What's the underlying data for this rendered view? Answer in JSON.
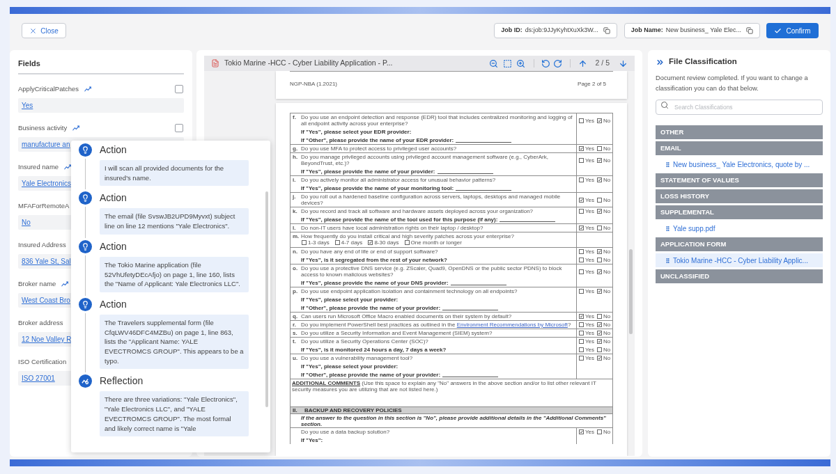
{
  "top_bar": {
    "close_button": {
      "label": "Close"
    },
    "job_id": {
      "label": "Job ID:",
      "value": "ds:job:9JJyKyhtXuXk3W..."
    },
    "job_name": {
      "label": "Job Name:",
      "value": "New business_ Yale Elec..."
    },
    "confirm_button": {
      "label": "Confirm"
    }
  },
  "fields_panel": {
    "title": "Fields",
    "fields": [
      {
        "label": "ApplyCriticalPatches",
        "extracted": true,
        "checked": false,
        "value": "Yes"
      },
      {
        "label": "Business activity",
        "extracted": true,
        "checked": false,
        "value": "manufacture an"
      },
      {
        "label": "Insured name",
        "extracted": true,
        "value": "Yale Electronics"
      },
      {
        "label": "MFAForRemoteA",
        "value": "No"
      },
      {
        "label": "Insured Address",
        "value": "836 Yale St, Sal"
      },
      {
        "label": "Broker name",
        "extracted": true,
        "value": "West Coast Bro"
      },
      {
        "label": "Broker address",
        "value": "12 Noe Valley R"
      },
      {
        "label": "ISO Certification",
        "value": "ISO 27001"
      }
    ]
  },
  "reasoning_popover": {
    "steps": [
      {
        "kind": "action",
        "title": "Action",
        "text": "I will scan all provided documents for the insured's name."
      },
      {
        "kind": "action",
        "title": "Action",
        "text": "The email (file SvswJB2UPD9Myvxt) subject line on line 12 mentions \"Yale Electronics\"."
      },
      {
        "kind": "action",
        "title": "Action",
        "text": "The Tokio Marine application (file 52VhUfetyDEcAfjo) on page 1, line 160, lists the \"Name of Applicant: Yale Electronics LLC\"."
      },
      {
        "kind": "action",
        "title": "Action",
        "text": "The Travelers supplemental form (file CfqLWV46DFC4MZBu) on page 1, line 863, lists the \"Applicant Name: YALE EVECTROMCS GROUP\". This appears to be a typo."
      },
      {
        "kind": "reflection",
        "title": "Reflection",
        "text": "There are three variations: \"Yale Electronics\", \"Yale Electronics LLC\", and \"YALE EVECTROMCS GROUP\". The most formal and likely correct name is \"Yale"
      }
    ]
  },
  "document_viewer": {
    "title": "Tokio Marine -HCC - Cyber Liability Application - P...",
    "page_indicator": "2 / 5",
    "previous_page": {
      "form_code": "NGP-NBA (1.2021)",
      "page_label": "Page 2 of 5"
    },
    "page": {
      "questions": [
        {
          "kind": "yes_no",
          "letter": "f.",
          "text": "Do you use an endpoint detection and response (EDR) tool that includes centralized monitoring and logging of all endpoint activity across your enterprise?",
          "options": [
            {
              "label": "Yes",
              "checked": false
            },
            {
              "label": "No",
              "checked": true
            }
          ],
          "followups": [
            {
              "text": "If \"Yes\", please select your EDR provider:"
            },
            {
              "text": "If \"Other\", please provide the name of your EDR provider:",
              "blank": true
            }
          ]
        },
        {
          "kind": "yes_no",
          "letter": "g.",
          "text": "Do you use MFA to protect access to privileged user accounts?",
          "options": [
            {
              "label": "Yes",
              "checked": true
            },
            {
              "label": "No",
              "checked": false
            }
          ]
        },
        {
          "kind": "yes_no",
          "letter": "h.",
          "text": "Do you manage privileged accounts using privileged account management software (e.g., CyberArk, BeyondTrust, etc.)?",
          "options": [
            {
              "label": "Yes",
              "checked": false
            },
            {
              "label": "No",
              "checked": true
            }
          ],
          "followups": [
            {
              "text": "If \"Yes\", please provide the name of your provider:",
              "blank": true
            }
          ]
        },
        {
          "kind": "yes_no",
          "letter": "i.",
          "text": "Do you actively monitor all administrator access for unusual behavior patterns?",
          "options": [
            {
              "label": "Yes",
              "checked": false
            },
            {
              "label": "No",
              "checked": true
            }
          ],
          "followups": [
            {
              "text": "If \"Yes\", please provide the name of your monitoring tool:",
              "blank": true
            }
          ]
        },
        {
          "kind": "yes_no",
          "letter": "j.",
          "text": "Do you roll out a hardened baseline configuration across servers, laptops, desktops and managed mobile devices?",
          "options": [
            {
              "label": "Yes",
              "checked": true
            },
            {
              "label": "No",
              "checked": false
            }
          ]
        },
        {
          "kind": "yes_no",
          "letter": "k.",
          "text": "Do you record and track all software and hardware assets deployed across your organization?",
          "options": [
            {
              "label": "Yes",
              "checked": false
            },
            {
              "label": "No",
              "checked": true
            }
          ],
          "followups": [
            {
              "text": "If \"Yes\", please provide the name of the tool used for this purpose (if any):",
              "blank": true
            }
          ]
        },
        {
          "kind": "yes_no",
          "letter": "l.",
          "text": "Do non-IT users have local administration rights on their laptop / desktop?",
          "options": [
            {
              "label": "Yes",
              "checked": true
            },
            {
              "label": "No",
              "checked": false
            }
          ]
        },
        {
          "kind": "choice",
          "letter": "m.",
          "text": "How frequently do you install critical and high severity patches across your enterprise?",
          "options": [
            {
              "label": "1-3 days",
              "checked": false
            },
            {
              "label": "4-7 days",
              "checked": false
            },
            {
              "label": "8-30 days",
              "checked": true
            },
            {
              "label": "One month or longer",
              "checked": false
            }
          ]
        },
        {
          "kind": "yes_no",
          "letter": "n.",
          "text": "Do you have any end of life or end of support software?",
          "options": [
            {
              "label": "Yes",
              "checked": false
            },
            {
              "label": "No",
              "checked": true
            }
          ],
          "followups": [
            {
              "text": "If \"Yes\", is it segregated from the rest of your network?",
              "options": [
                {
                  "label": "Yes",
                  "checked": false
                },
                {
                  "label": "No",
                  "checked": false
                }
              ]
            }
          ]
        },
        {
          "kind": "yes_no",
          "letter": "o.",
          "text": "Do you use a protective DNS service (e.g. ZScaler, Quad9, OpenDNS or the public sector PDNS) to block access to known malicious websites?",
          "options": [
            {
              "label": "Yes",
              "checked": false
            },
            {
              "label": "No",
              "checked": true
            }
          ],
          "followups": [
            {
              "text": "If \"Yes\", please provide the name of your DNS provider:",
              "blank": true
            }
          ]
        },
        {
          "kind": "yes_no",
          "letter": "p.",
          "text": "Do you use endpoint application isolation and containment technology on all endpoints?",
          "options": [
            {
              "label": "Yes",
              "checked": false
            },
            {
              "label": "No",
              "checked": true
            }
          ],
          "followups": [
            {
              "text": "If \"Yes\", please select your provider:"
            },
            {
              "text": "If \"Other\", please provide the name of your provider:",
              "blank": true
            }
          ]
        },
        {
          "kind": "yes_no",
          "letter": "q.",
          "text": "Can users run Microsoft Office Macro enabled documents on their system by default?",
          "options": [
            {
              "label": "Yes",
              "checked": true
            },
            {
              "label": "No",
              "checked": false
            }
          ]
        },
        {
          "kind": "yes_no",
          "letter": "r.",
          "text": "Do you implement PowerShell best practices as outlined in the",
          "link": "Environment Recommendations by Microsoft",
          "text_end": "?",
          "options": [
            {
              "label": "Yes",
              "checked": false
            },
            {
              "label": "No",
              "checked": true
            }
          ]
        },
        {
          "kind": "yes_no",
          "letter": "s.",
          "text": "Do you utilize a Security Information and Event Management (SIEM) system?",
          "options": [
            {
              "label": "Yes",
              "checked": false
            },
            {
              "label": "No",
              "checked": true
            }
          ]
        },
        {
          "kind": "yes_no",
          "letter": "t.",
          "text": "Do you utilize a Security Operations Center (SOC)?",
          "options": [
            {
              "label": "Yes",
              "checked": false
            },
            {
              "label": "No",
              "checked": true
            }
          ],
          "followups": [
            {
              "text": "If \"Yes\", is it monitored 24 hours a day, 7 days a week?",
              "options": [
                {
                  "label": "Yes",
                  "checked": false
                },
                {
                  "label": "No",
                  "checked": false
                }
              ]
            }
          ]
        },
        {
          "kind": "yes_no",
          "letter": "u.",
          "text": "Do you use a vulnerability management tool?",
          "options": [
            {
              "label": "Yes",
              "checked": false
            },
            {
              "label": "No",
              "checked": true
            }
          ],
          "followups": [
            {
              "text": "If \"Yes\", please select your provider:"
            },
            {
              "text": "If \"Other\", please provide the name of your provider:",
              "blank": true
            }
          ]
        }
      ],
      "comments": {
        "text": "**ADDITIONAL COMMENTS** (Use this space to explain any \"No\" answers in the above section and/or to list other relevant IT security measures you are utilizing that are not listed here.)"
      },
      "section": {
        "number": "II.",
        "title": "BACKUP AND RECOVERY POLICIES",
        "note": "If the answer to the question in this section is \"No\", please provide additional details in the \"Additional Comments\" section.",
        "questions": [
          {
            "kind": "yes_no",
            "text": "Do you use a data backup solution?",
            "options": [
              {
                "label": "Yes",
                "checked": true
              },
              {
                "label": "No",
                "checked": false
              }
            ],
            "followups": [
              {
                "text": "If \"Yes\":"
              }
            ]
          }
        ]
      }
    }
  },
  "file_classification": {
    "title": "File Classification",
    "description": "Document review completed. If you want to change a classification you can do that below.",
    "search": {
      "placeholder": "Search Classifications"
    },
    "categories": [
      {
        "name": "OTHER"
      },
      {
        "name": "EMAIL",
        "files": [
          {
            "name": "New business_ Yale Electronics, quote by ...",
            "selected": false
          }
        ]
      },
      {
        "name": "STATEMENT OF VALUES"
      },
      {
        "name": "LOSS HISTORY"
      },
      {
        "name": "SUPPLEMENTAL",
        "files": [
          {
            "name": "Yale supp.pdf",
            "selected": false
          }
        ]
      },
      {
        "name": "APPLICATION FORM",
        "files": [
          {
            "name": "Tokio Marine -HCC - Cyber Liability Applic...",
            "selected": true
          }
        ]
      },
      {
        "name": "UNCLASSIFIED"
      }
    ]
  }
}
